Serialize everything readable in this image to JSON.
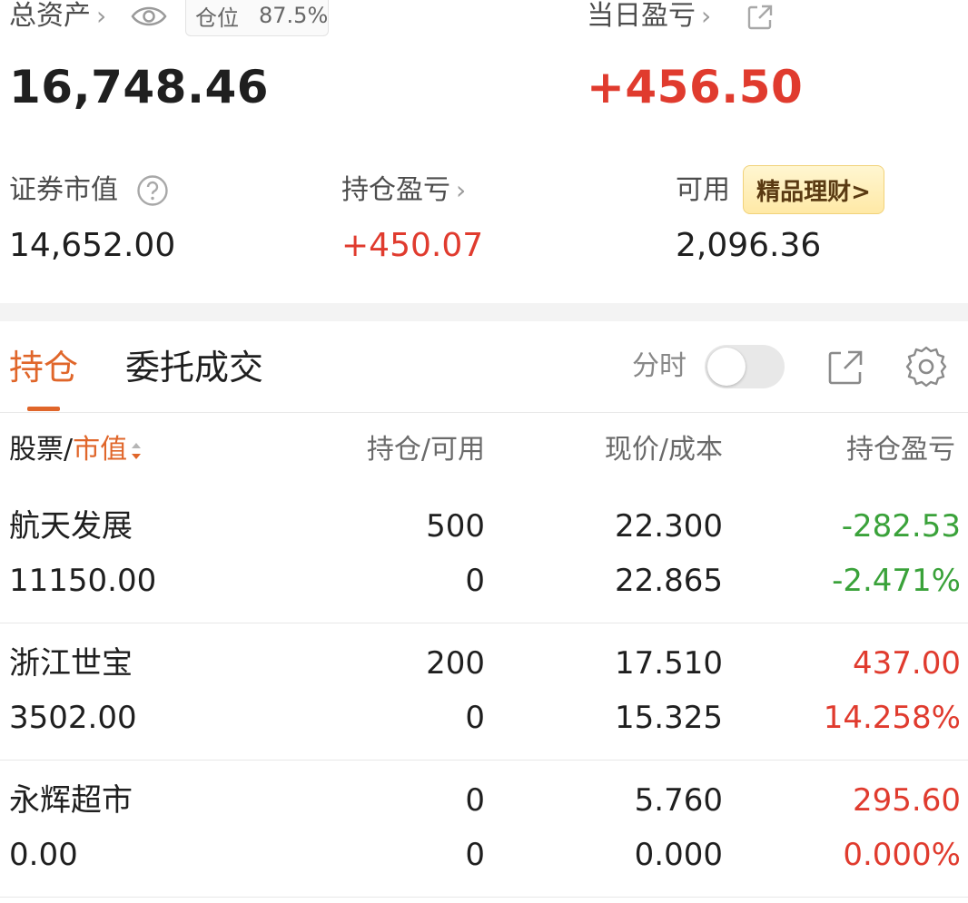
{
  "summary": {
    "total_assets_label": "总资产",
    "total_assets_value": "16,748.46",
    "position_label": "仓位",
    "position_value": "87.5%",
    "daily_pnl_label": "当日盈亏",
    "daily_pnl_value": "+456.50",
    "market_value_label": "证券市值",
    "market_value": "14,652.00",
    "holding_pnl_label": "持仓盈亏",
    "holding_pnl_value": "+450.07",
    "available_label": "可用",
    "available_value": "2,096.36",
    "wealth_button": "精品理财>"
  },
  "tabs": {
    "holdings": "持仓",
    "orders": "委托成交",
    "intraday_label": "分时",
    "intraday_toggle": false
  },
  "table": {
    "headers": {
      "stock": "股票/",
      "stock_sort": "市值",
      "holding": "持仓/可用",
      "price": "现价/成本",
      "pnl": "持仓盈亏"
    },
    "rows": [
      {
        "name": "航天发展",
        "market_value": "11150.00",
        "holding": "500",
        "available": "0",
        "price": "22.300",
        "cost": "22.865",
        "pnl": "-282.53",
        "pnl_pct": "-2.471%",
        "color": "#3aa23a"
      },
      {
        "name": "浙江世宝",
        "market_value": "3502.00",
        "holding": "200",
        "available": "0",
        "price": "17.510",
        "cost": "15.325",
        "pnl": "437.00",
        "pnl_pct": "14.258%",
        "color": "#e03b2e"
      },
      {
        "name": "永辉超市",
        "market_value": "0.00",
        "holding": "0",
        "available": "0",
        "price": "5.760",
        "cost": "0.000",
        "pnl": "295.60",
        "pnl_pct": "0.000%",
        "color": "#e03b2e"
      }
    ]
  },
  "colors": {
    "accent": "#e0662a",
    "up": "#e03b2e",
    "down": "#3aa23a"
  }
}
